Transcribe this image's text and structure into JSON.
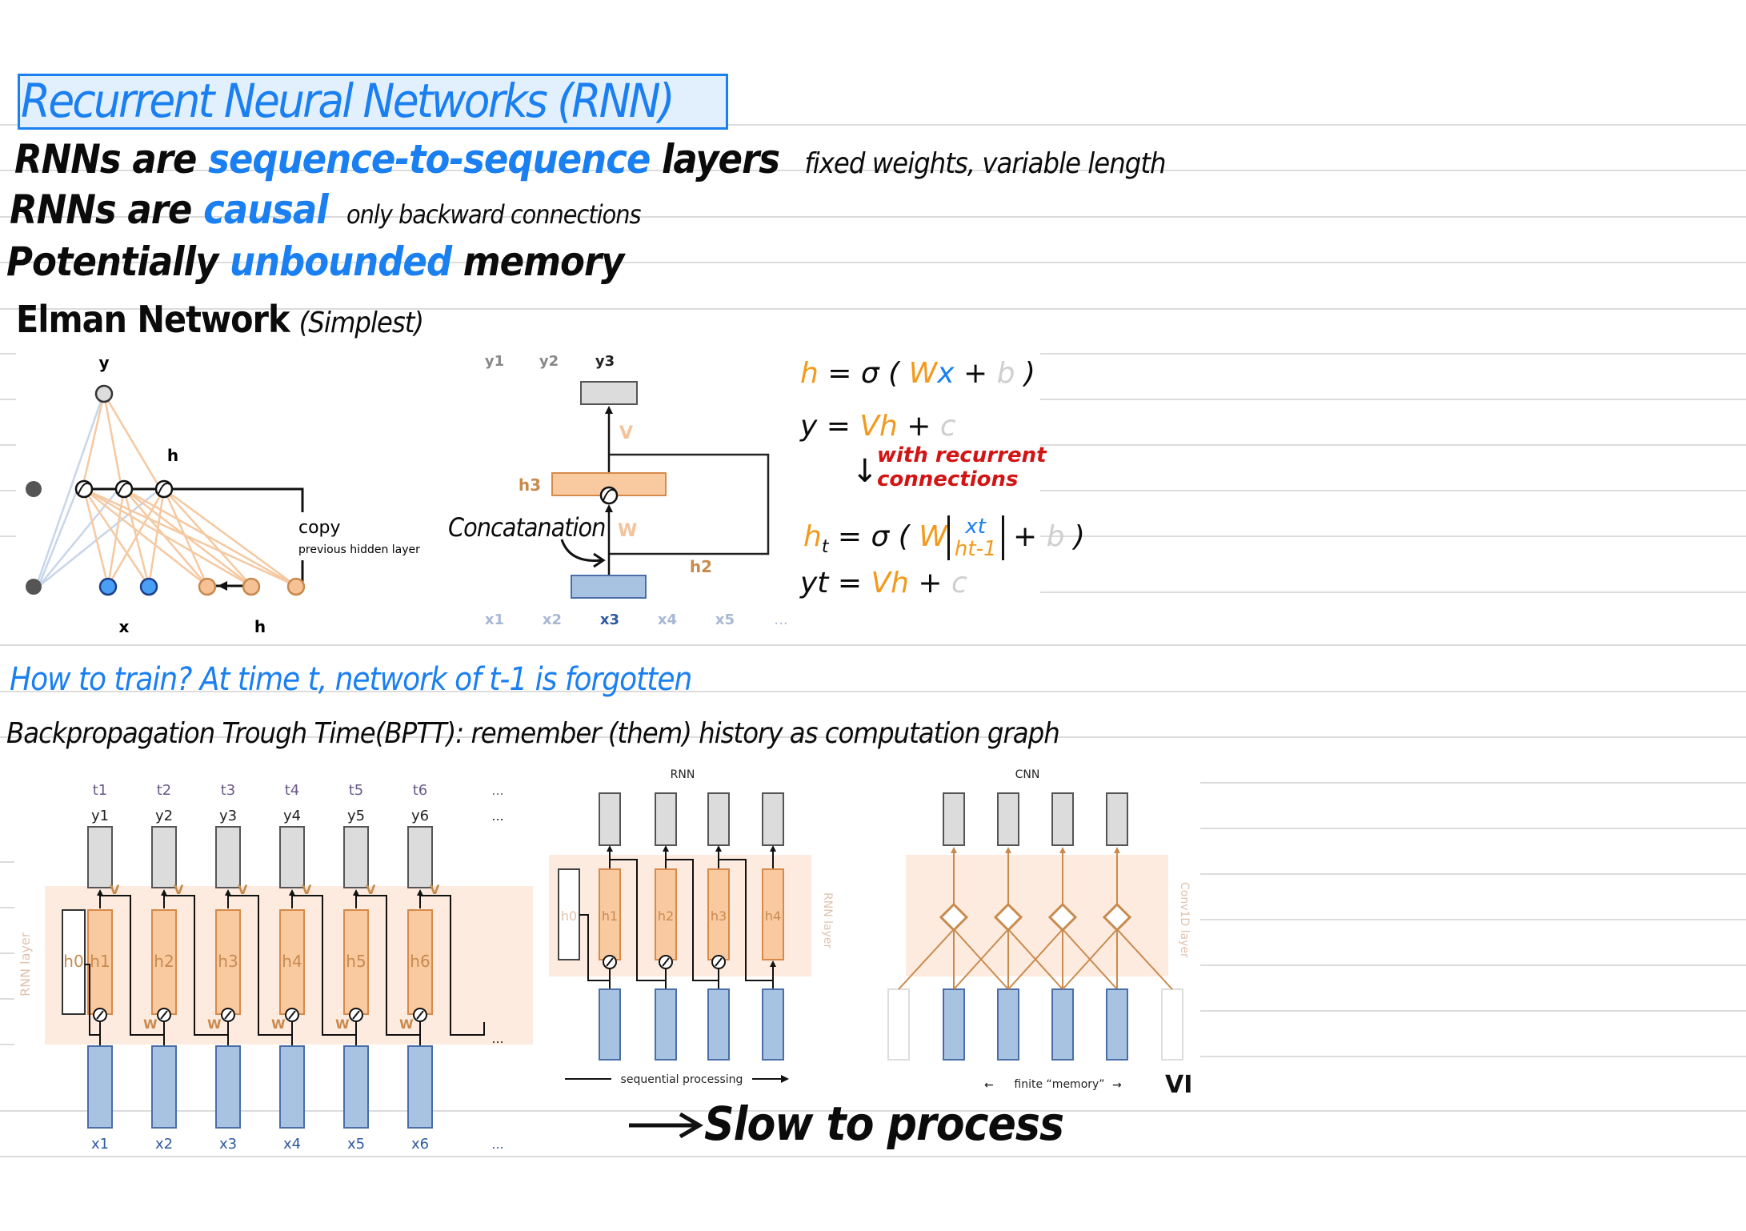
{
  "title": "Recurrent Neural Networks (RNN)",
  "lines": {
    "l1": {
      "a": "RNNs are ",
      "b": "sequence-to-sequence",
      "c": " layers",
      "d": "fixed weights, variable length"
    },
    "l2": {
      "a": "RNNs are ",
      "b": "causal",
      "c": "only backward connections"
    },
    "l3": {
      "a": "Potentially ",
      "b": "unbounded",
      "c": " memory"
    },
    "l4": {
      "a": "Elman Network",
      "b": "(Simplest)"
    }
  },
  "elman": {
    "y_label": "y",
    "h_label": "h",
    "x_label": "x",
    "h_bottom_label": "h",
    "copy_label": "copy",
    "copy_sub": "previous hidden layer"
  },
  "unrolled_single": {
    "y_labels": [
      "y1",
      "y2",
      "y3"
    ],
    "x_labels": [
      "x1",
      "x2",
      "x3",
      "x4",
      "x5",
      "..."
    ],
    "h3": "h3",
    "h2": "h2",
    "v": "V",
    "w": "W",
    "concat_note": "Concatanation"
  },
  "equations": {
    "eq1": {
      "h": "h",
      "eq": " = σ ( ",
      "w": "W",
      "x": "x",
      "plus": " + ",
      "b": "b",
      "close": " )"
    },
    "eq2": {
      "y": "y = ",
      "vh": "Vh",
      "plus": " + ",
      "c": "c"
    },
    "note_arrow": "↓",
    "note": [
      "with recurrent",
      "connections"
    ],
    "eq3": {
      "h": "h",
      "t": "t",
      "eq": " = σ ( ",
      "w": "W",
      "xt": "xt",
      "ht1": "ht-1",
      "plus": " + ",
      "b": "b",
      "close": " )"
    },
    "eq4": {
      "y": "yt = ",
      "vh": "Vh",
      "plus": " + ",
      "c": "c"
    }
  },
  "train": {
    "question": "How to train? At time t, network of t-1 is forgotten",
    "bptt": "Backpropagation Trough Time(BPTT): remember (them) history as computation graph"
  },
  "bptt_diagram": {
    "t_labels": [
      "t1",
      "t2",
      "t3",
      "t4",
      "t5",
      "t6",
      "..."
    ],
    "y_labels": [
      "y1",
      "y2",
      "y3",
      "y4",
      "y5",
      "y6",
      "..."
    ],
    "h_labels": [
      "h0",
      "h1",
      "h2",
      "h3",
      "h4",
      "h5",
      "h6"
    ],
    "x_labels": [
      "x1",
      "x2",
      "x3",
      "x4",
      "x5",
      "x6",
      "..."
    ],
    "v": "V",
    "w": "W",
    "layer_label": "RNN layer",
    "ellipsis": "..."
  },
  "rnn_diagram": {
    "title": "RNN",
    "h_labels": [
      "h0",
      "h1",
      "h2",
      "h3",
      "h4"
    ],
    "layer_label": "RNN layer",
    "caption": "sequential processing"
  },
  "cnn_diagram": {
    "title": "CNN",
    "layer_label": "Conv1D layer",
    "caption": "finite “memory”",
    "clipped": "VI"
  },
  "conclusion": "Slow to process"
}
